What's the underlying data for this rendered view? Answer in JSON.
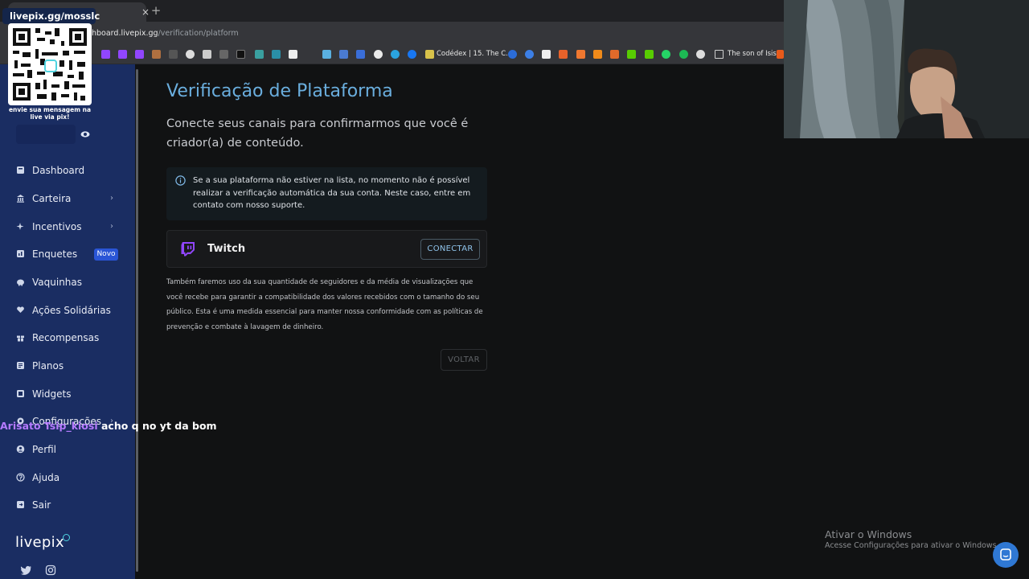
{
  "browser": {
    "tab_close": "×",
    "new_tab": "+",
    "url_host": "hboard.livepix.gg",
    "url_path": "/verification/platform",
    "bookmarks": [
      "Codédex | 15. The C...",
      "The son of Isis"
    ]
  },
  "overlay": {
    "qr_title": "livepix.gg/mosslc",
    "qr_caption": "envie sua mensagem na live via pix!",
    "chat_user": "Arisato Tsip_kiosi",
    "chat_message": "acho q no yt da bom"
  },
  "sidebar": {
    "items": [
      {
        "label": "Dashboard",
        "icon": "dashboard-icon"
      },
      {
        "label": "Carteira",
        "icon": "wallet-icon",
        "chevron": "›"
      },
      {
        "label": "Incentivos",
        "icon": "sparkle-icon",
        "chevron": "›"
      },
      {
        "label": "Enquetes",
        "icon": "poll-icon",
        "badge": "Novo"
      },
      {
        "label": "Vaquinhas",
        "icon": "piggy-icon"
      },
      {
        "label": "Ações Solidárias",
        "icon": "heart-hand-icon"
      },
      {
        "label": "Recompensas",
        "icon": "gift-icon"
      },
      {
        "label": "Planos",
        "icon": "plans-icon"
      },
      {
        "label": "Widgets",
        "icon": "widgets-icon"
      },
      {
        "label": "Configurações",
        "icon": "settings-icon",
        "chevron": "›"
      },
      {
        "label": "Perfil",
        "icon": "user-icon"
      },
      {
        "label": "Ajuda",
        "icon": "help-icon"
      },
      {
        "label": "Sair",
        "icon": "logout-icon"
      }
    ],
    "brand": "livepix"
  },
  "main": {
    "title": "Verificação de Plataforma",
    "subtitle": "Conecte seus canais para confirmarmos que você é criador(a) de conteúdo.",
    "info": "Se a sua plataforma não estiver na lista, no momento não é possível realizar a verificação automática da sua conta. Neste caso, entre em contato com nosso suporte.",
    "platform_name": "Twitch",
    "connect_label": "CONECTAR",
    "disclaimer": "Também faremos uso da sua quantidade de seguidores e da média de visualizações que você recebe para garantir a compatibilidade dos valores recebidos com o tamanho do seu público. Esta é uma medida essencial para manter nossa conformidade com as políticas de prevenção e combate à lavagem de dinheiro.",
    "back_label": "VOLTAR"
  },
  "windows": {
    "watermark_title": "Ativar o Windows",
    "watermark_sub": "Acesse Configurações para ativar o Windows."
  },
  "colors": {
    "sidebar": "#1a2d62",
    "title": "#6aaede",
    "twitch": "#9146ff",
    "badge": "#2a55d6"
  }
}
